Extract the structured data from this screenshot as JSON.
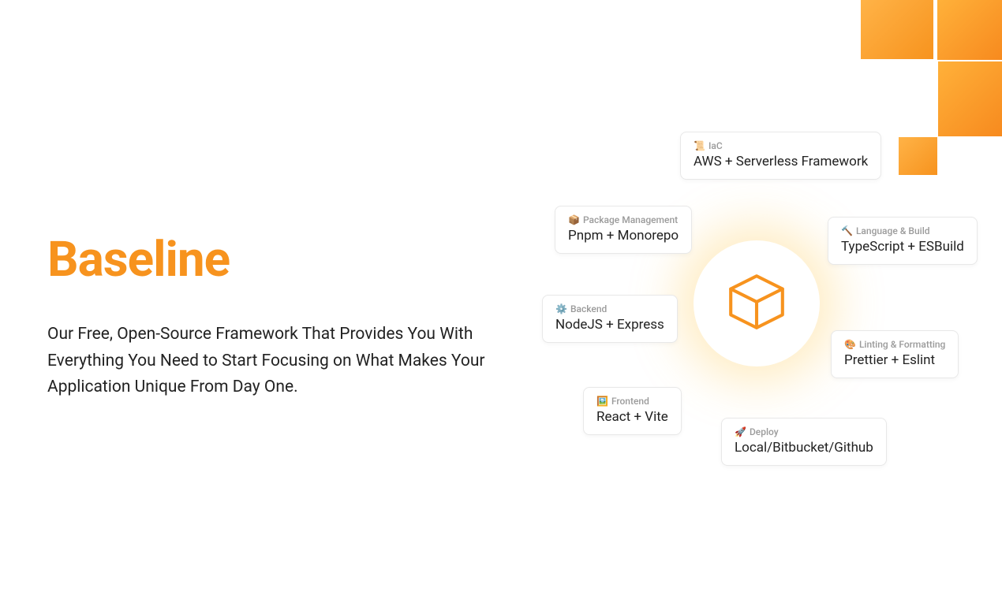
{
  "hero": {
    "title": "Baseline",
    "subtitle": "Our Free, Open-Source Framework That Provides You With Everything You Need to Start Focusing on What Makes Your Application Unique From Day One."
  },
  "cards": {
    "iac": {
      "emoji": "📜",
      "label": "IaC",
      "value": "AWS + Serverless Framework"
    },
    "pkg": {
      "emoji": "📦",
      "label": "Package Management",
      "value": "Pnpm + Monorepo"
    },
    "lang": {
      "emoji": "🔨",
      "label": "Language & Build",
      "value": "TypeScript + ESBuild"
    },
    "backend": {
      "emoji": "⚙️",
      "label": "Backend",
      "value": "NodeJS + Express"
    },
    "lint": {
      "emoji": "🎨",
      "label": "Linting & Formatting",
      "value": "Prettier + Eslint"
    },
    "frontend": {
      "emoji": "🖼️",
      "label": "Frontend",
      "value": "React + Vite"
    },
    "deploy": {
      "emoji": "🚀",
      "label": "Deploy",
      "value": "Local/Bitbucket/Github"
    }
  }
}
